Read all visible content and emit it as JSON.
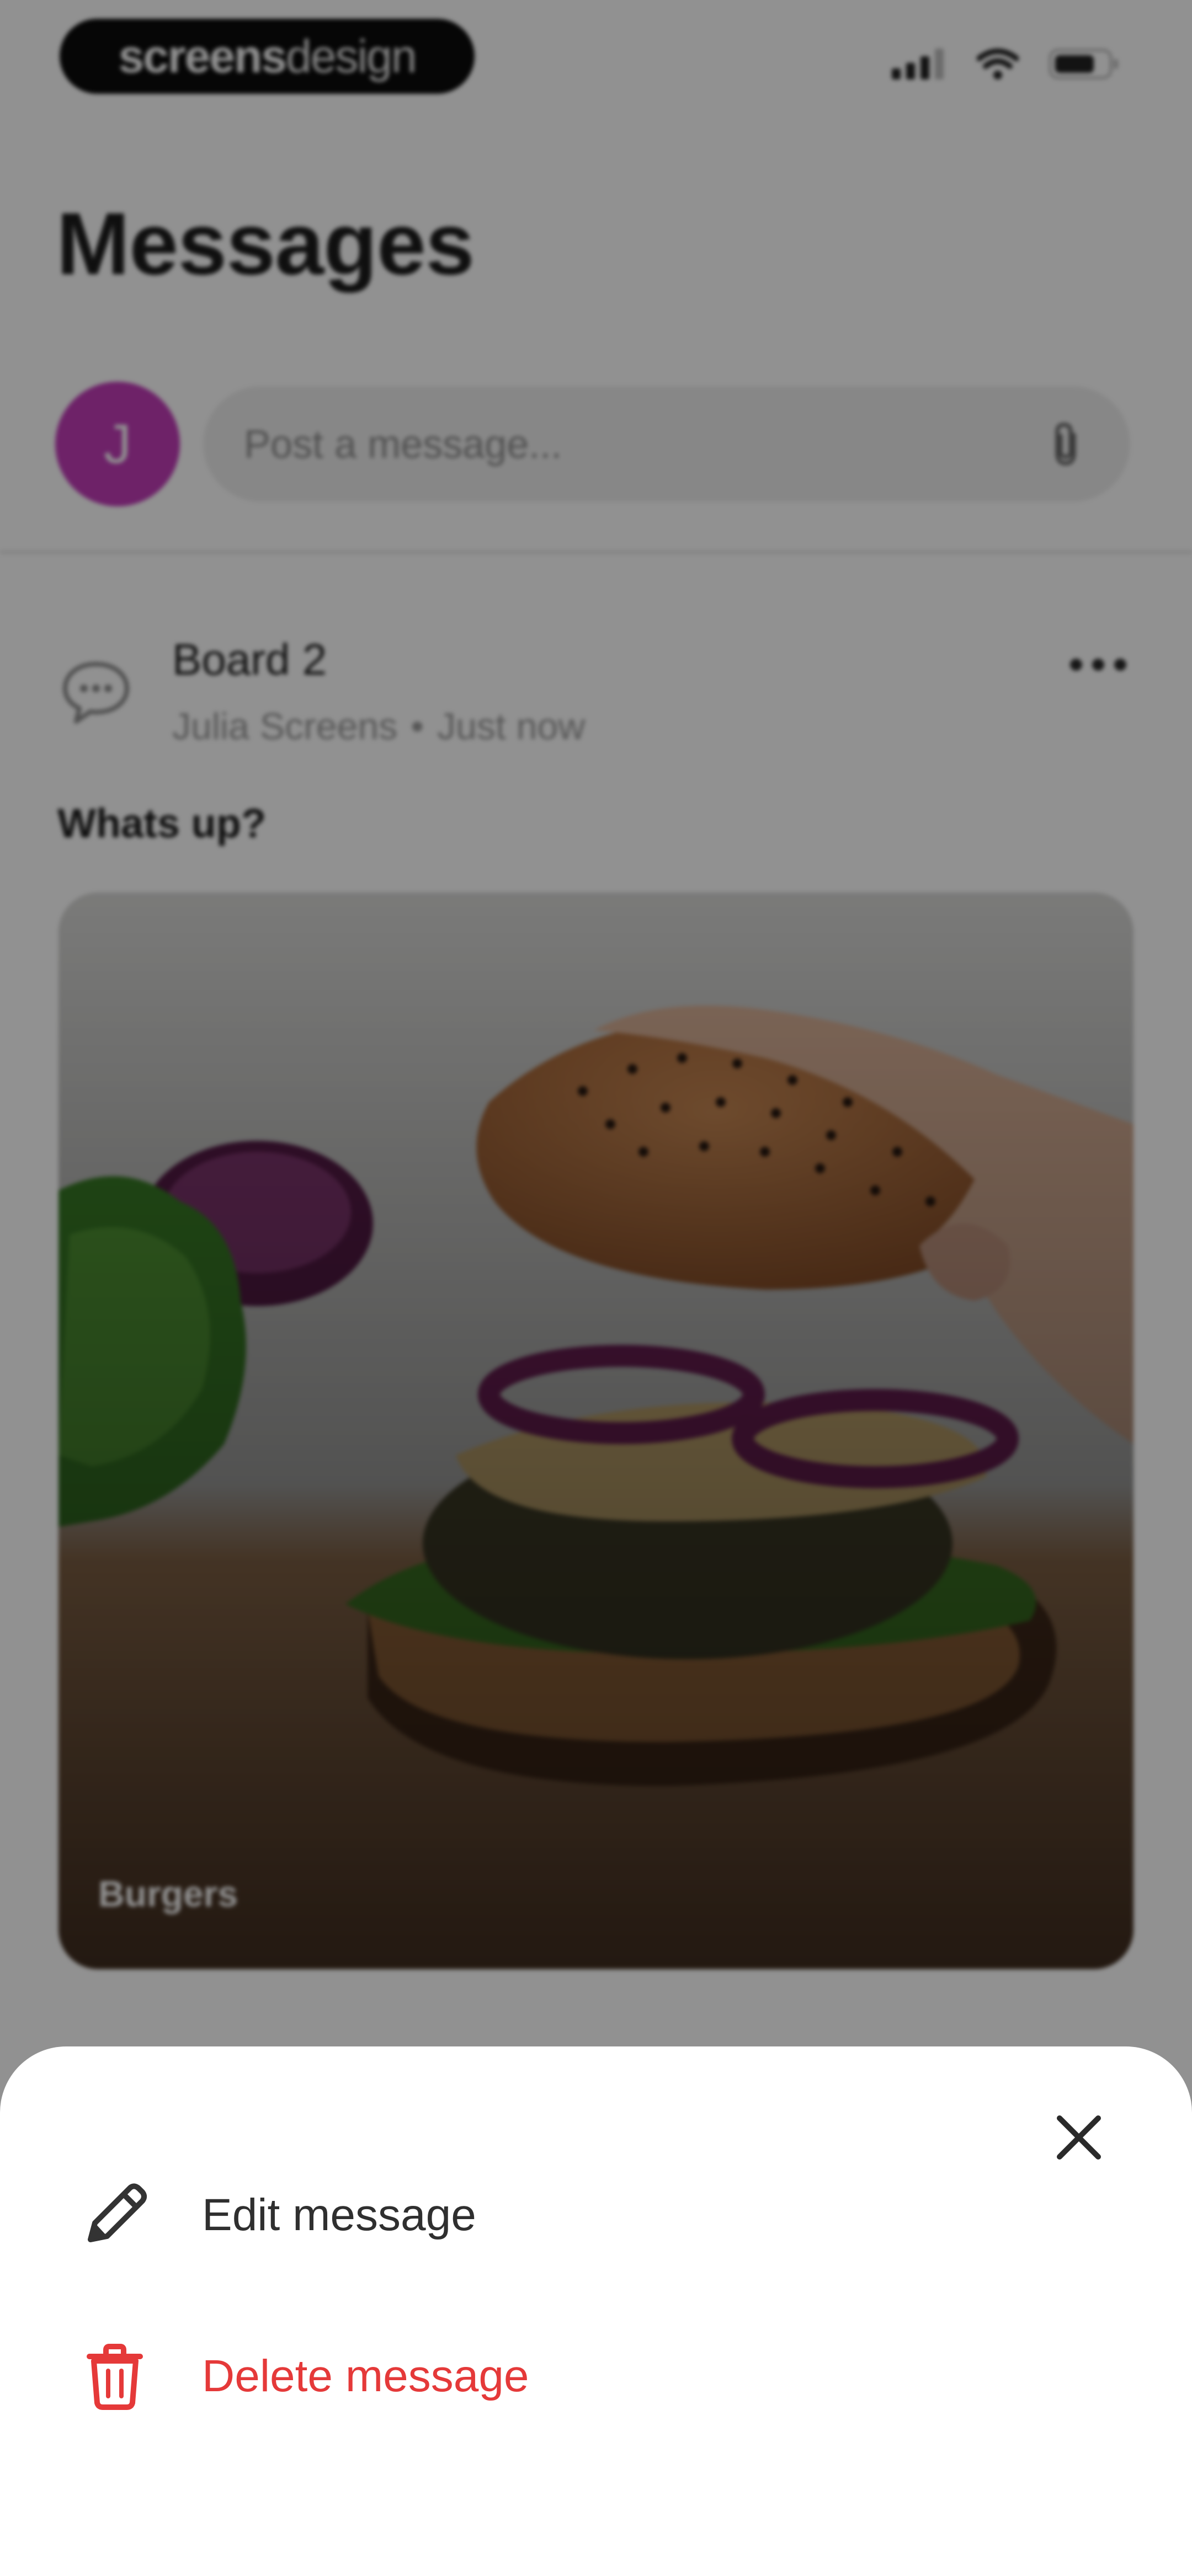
{
  "brand": {
    "logo_bold": "screens",
    "logo_light": "design"
  },
  "header": {
    "title": "Messages"
  },
  "composer": {
    "avatar_initial": "J",
    "placeholder": "Post a message..."
  },
  "post": {
    "board": "Board 2",
    "author": "Julia Screens",
    "separator": "•",
    "time": "Just now",
    "text": "Whats up?",
    "image_caption": "Burgers"
  },
  "sheet": {
    "edit_label": "Edit message",
    "delete_label": "Delete message"
  },
  "colors": {
    "avatar": "#c13cb8",
    "danger": "#e53939",
    "overlay": "rgba(0,0,0,0.43)"
  },
  "icons": {
    "status": [
      "cellular-signal-icon",
      "wifi-icon",
      "battery-icon"
    ],
    "attach": "paperclip-icon",
    "post": "comment-bubble-icon",
    "more": "more-horizontal-icon",
    "close": "close-icon",
    "edit": "pencil-icon",
    "delete": "trash-icon"
  }
}
